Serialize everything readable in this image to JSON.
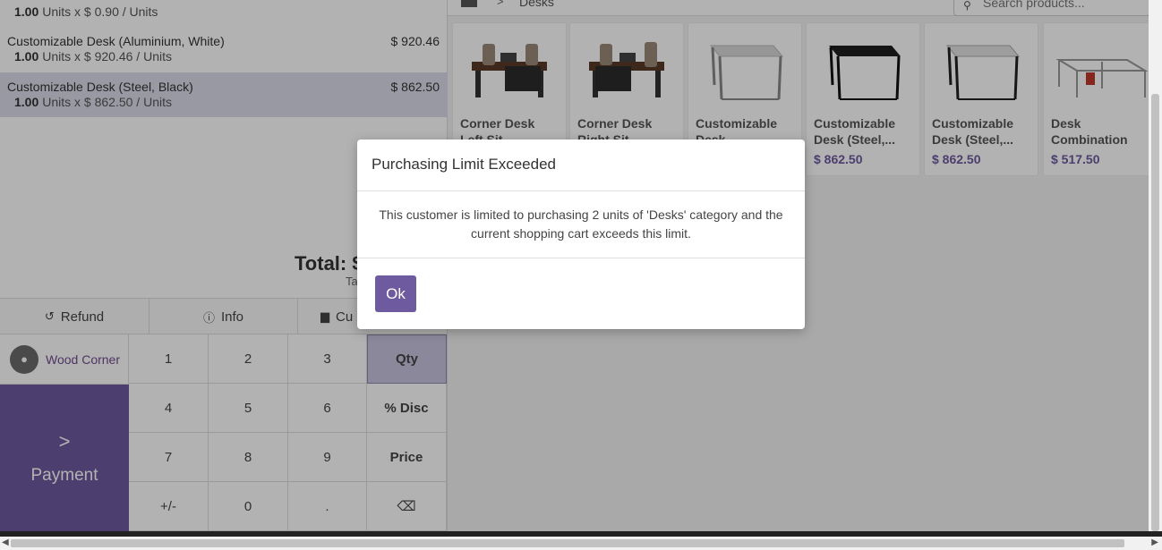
{
  "order": {
    "lines": [
      {
        "name": "",
        "qty": "1.00",
        "detail": "Units x $ 0.90 / Units",
        "price": ""
      },
      {
        "name": "Customizable Desk (Aluminium, White)",
        "qty": "1.00",
        "detail": "Units x $ 920.46 / Units",
        "price": "$ 920.46"
      },
      {
        "name": "Customizable Desk (Steel, Black)",
        "qty": "1.00",
        "detail": "Units x $ 862.50 / Units",
        "price": "$ 862.50"
      }
    ],
    "total_label": "Total: $",
    "taxes_label": "Ta"
  },
  "controls": {
    "refund_label": "Refund",
    "info_label": "Info",
    "customer_note_label": "Cu"
  },
  "customer": {
    "name": "Wood Corner"
  },
  "payment": {
    "label": "Payment"
  },
  "numpad": {
    "keys": [
      "1",
      "2",
      "3",
      "Qty",
      "4",
      "5",
      "6",
      "% Disc",
      "7",
      "8",
      "9",
      "Price",
      "+/-",
      "0",
      ".",
      "⌫"
    ]
  },
  "breadcrumb": {
    "separator": ">",
    "category": "Desks"
  },
  "search": {
    "placeholder": "Search products..."
  },
  "products": [
    {
      "name": "Corner Desk Left Sit",
      "price": ""
    },
    {
      "name": "Corner Desk Right Sit",
      "price": ""
    },
    {
      "name": "Customizable Desk (Aluminiu...",
      "price": ""
    },
    {
      "name": "Customizable Desk (Steel,...",
      "price": "$ 862.50"
    },
    {
      "name": "Customizable Desk (Steel,...",
      "price": "$ 862.50"
    },
    {
      "name": "Desk Combination",
      "price": "$ 517.50"
    }
  ],
  "dialog": {
    "title": "Purchasing Limit Exceeded",
    "message": "This customer is limited to purchasing 2 units of 'Desks' category and the current shopping cart exceeds this limit.",
    "ok_label": "Ok"
  },
  "colors": {
    "accent": "#6e5a9e",
    "selected_row": "#dcdcea"
  }
}
